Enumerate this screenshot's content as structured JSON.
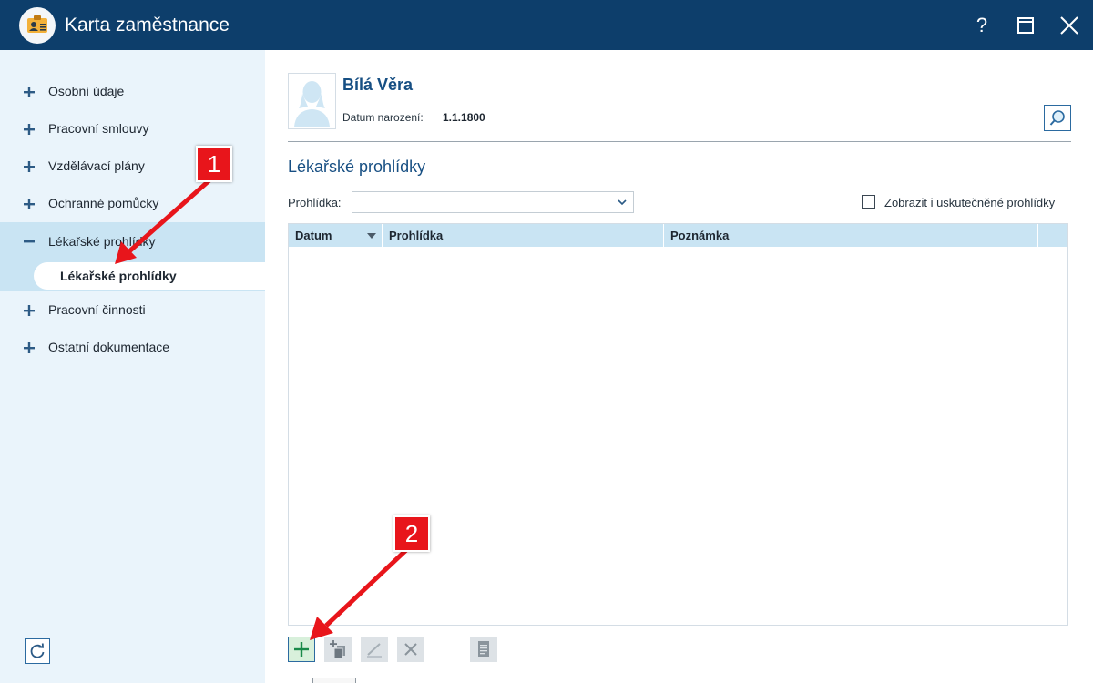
{
  "window": {
    "title": "Karta zaměstnance",
    "help": "?"
  },
  "sidebar": {
    "items": [
      {
        "label": "Osobní údaje",
        "expanded": false
      },
      {
        "label": "Pracovní smlouvy",
        "expanded": false
      },
      {
        "label": "Vzdělávací plány",
        "expanded": false
      },
      {
        "label": "Ochranné pomůcky",
        "expanded": false
      },
      {
        "label": "Lékařské prohlídky",
        "expanded": true
      },
      {
        "label": "Pracovní činnosti",
        "expanded": false
      },
      {
        "label": "Ostatní dokumentace",
        "expanded": false
      }
    ],
    "active_sub": "Lékařské prohlídky"
  },
  "employee": {
    "name": "Bílá Věra",
    "dob_label": "Datum narození:",
    "dob_value": "1.1.1800"
  },
  "section": {
    "title": "Lékařské prohlídky",
    "filter_label": "Prohlídka:",
    "filter_value": "",
    "checkbox_label": "Zobrazit i uskutečněné prohlídky",
    "checkbox_checked": false
  },
  "grid": {
    "columns": [
      "Datum",
      "Prohlídka",
      "Poznámka"
    ],
    "rows": []
  },
  "callouts": [
    "1",
    "2"
  ],
  "colors": {
    "titlebar": "#0d3e6b",
    "sidebar": "#eaf4fb",
    "active": "#c9e4f3",
    "accent": "#174f83",
    "callout": "#e8151b"
  }
}
